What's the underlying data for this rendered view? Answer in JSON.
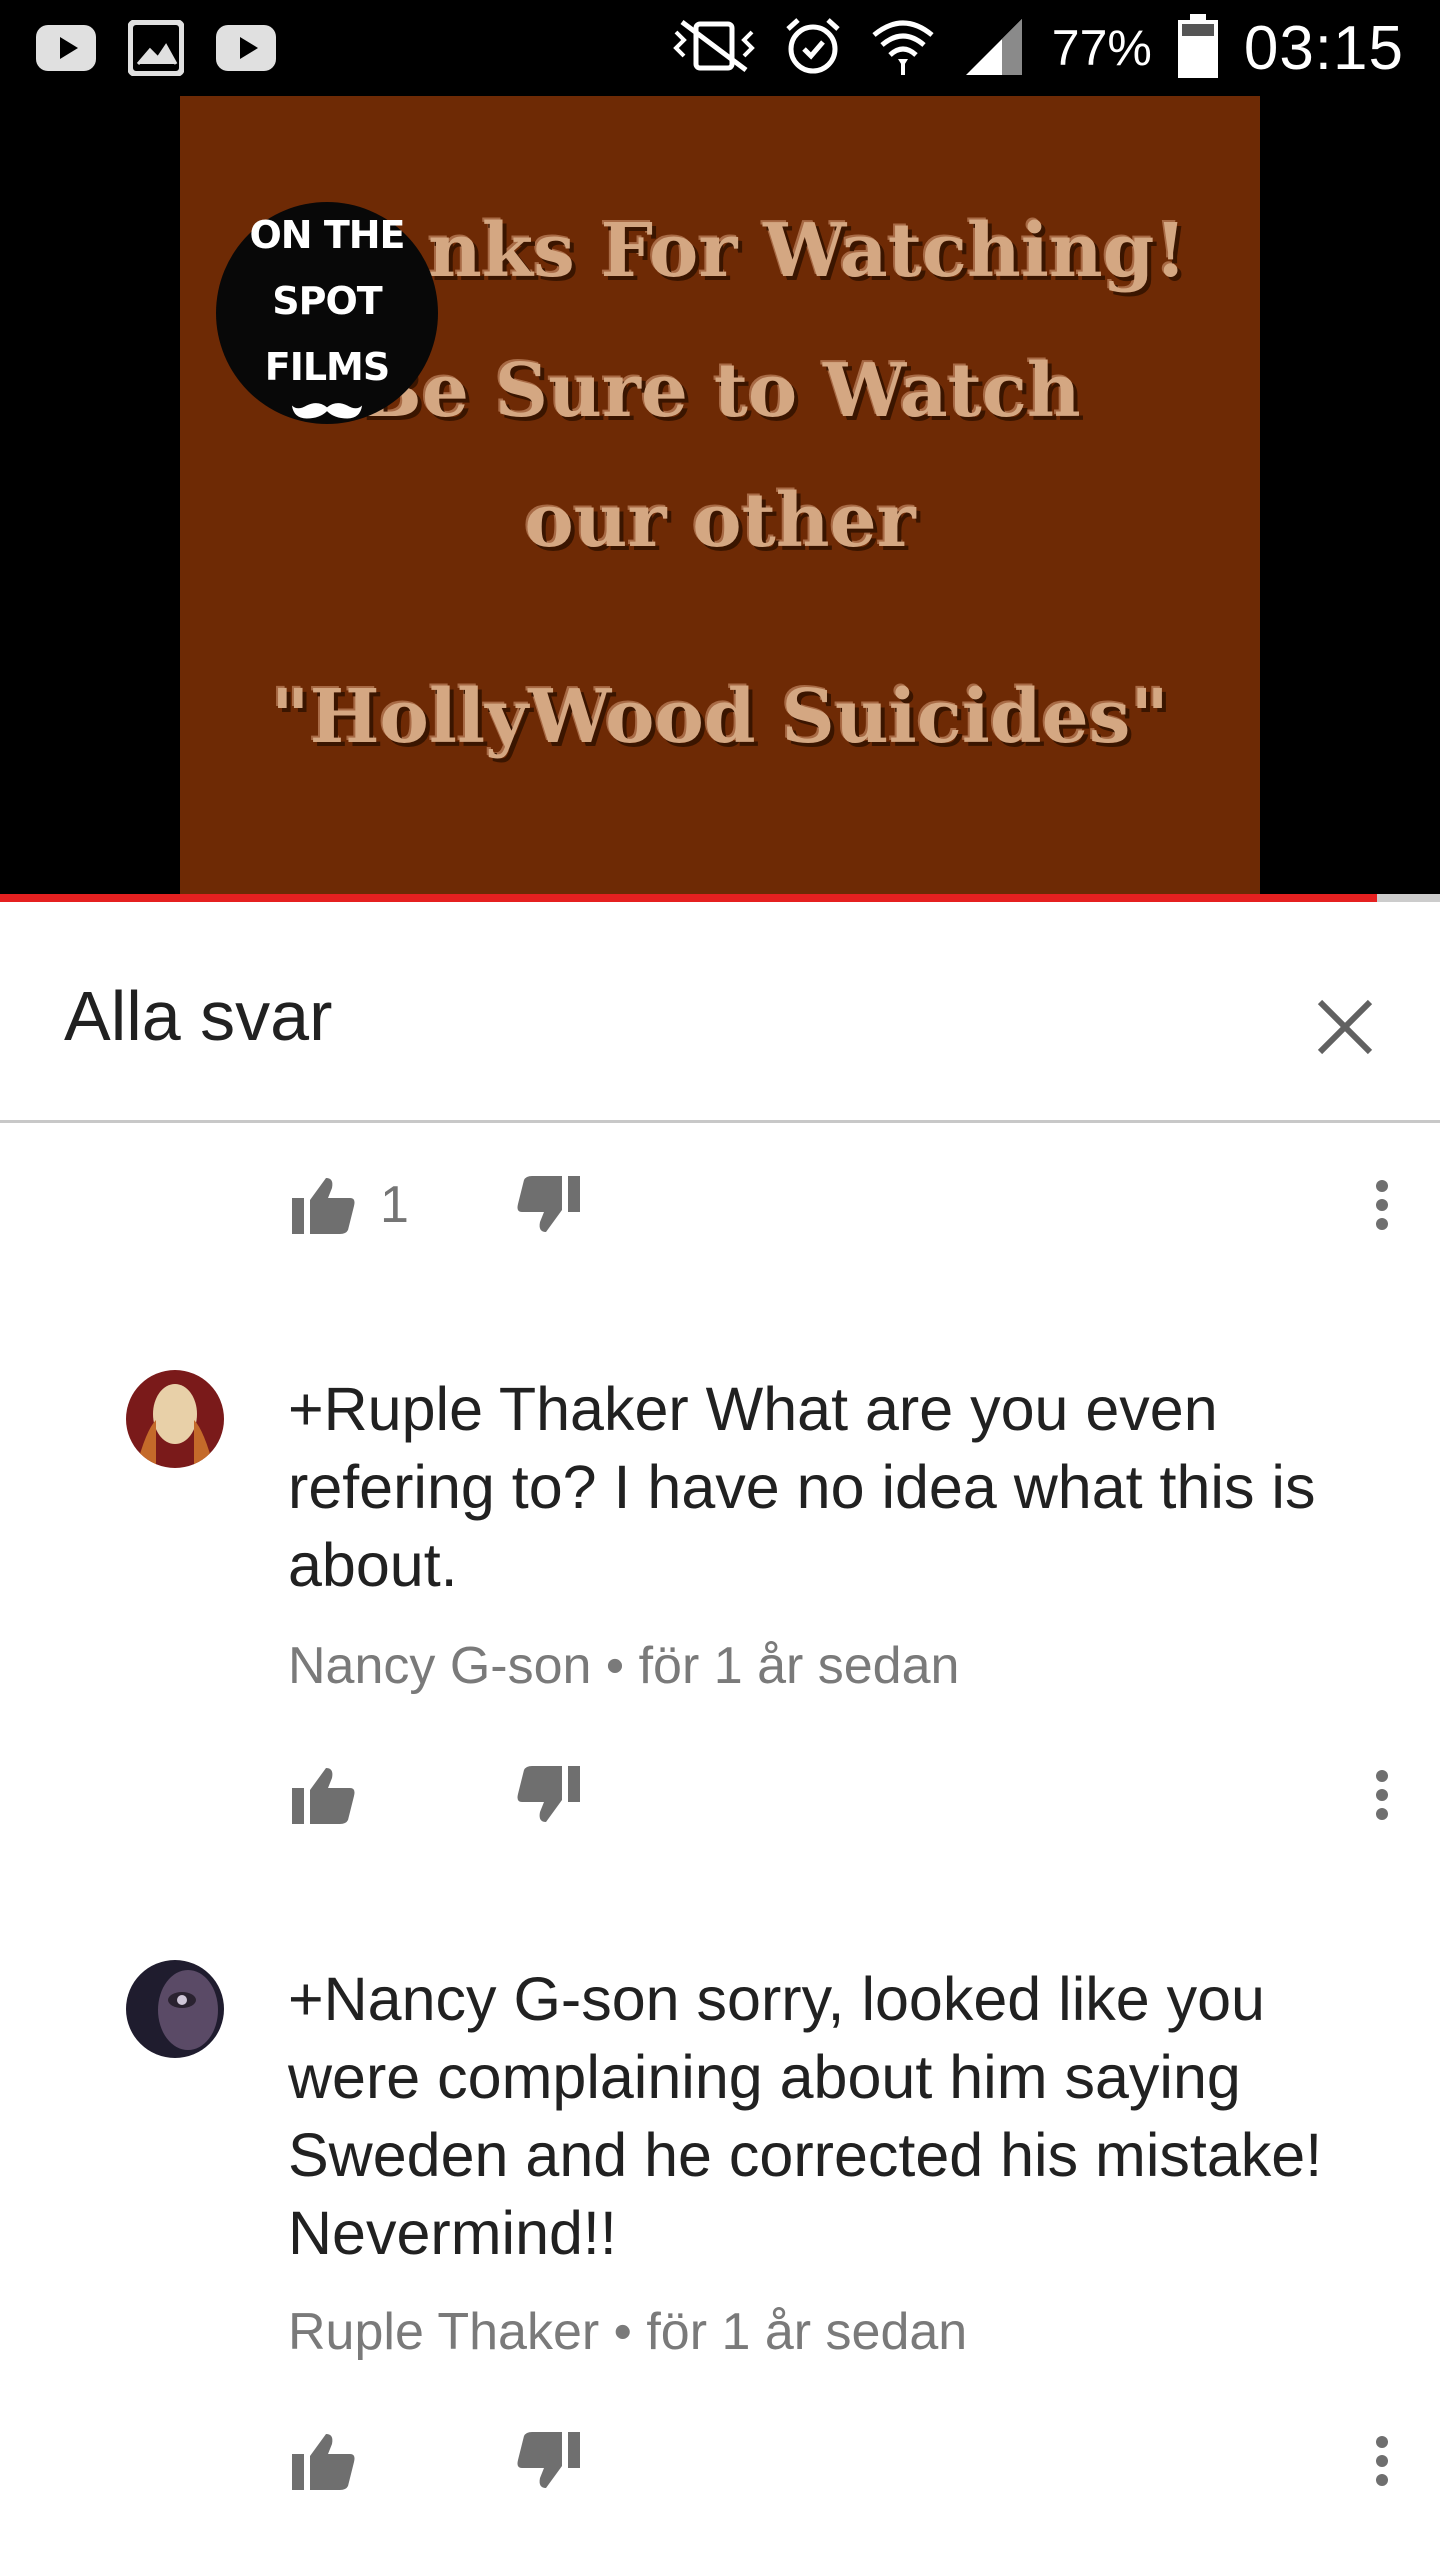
{
  "status_bar": {
    "left_icons": [
      "youtube-icon",
      "gallery-icon",
      "youtube-icon"
    ],
    "right_icons": [
      "vibrate-icon",
      "alarm-icon",
      "wifi-icon",
      "signal-icon",
      "battery-icon"
    ],
    "battery": "77%",
    "time": "03:15"
  },
  "video": {
    "lines": [
      "nks For Watching!",
      "Be Sure to Watch",
      "our other",
      "\"HollyWood Suicides\""
    ],
    "logo_line1": "ON THE",
    "logo_line2": "SPOT FILMS",
    "progress": 0.956,
    "colors": {
      "frame": "#6e2a05",
      "progress": "#e52020"
    }
  },
  "panel": {
    "title": "Alla svar",
    "close_icon": "close-icon"
  },
  "top_actions": {
    "like_count": "1"
  },
  "comments": [
    {
      "text": "+Ruple Thaker What are you even refering to? I have no idea what this is about.",
      "author": "Nancy G-son",
      "separator": "•",
      "time": "för 1 år sedan"
    },
    {
      "text": "+Nancy G-son sorry, looked like you were complaining about him saying Sweden and he corrected his mistake! Nevermind!!",
      "author": "Ruple Thaker",
      "separator": "•",
      "time": "för 1 år sedan"
    }
  ]
}
